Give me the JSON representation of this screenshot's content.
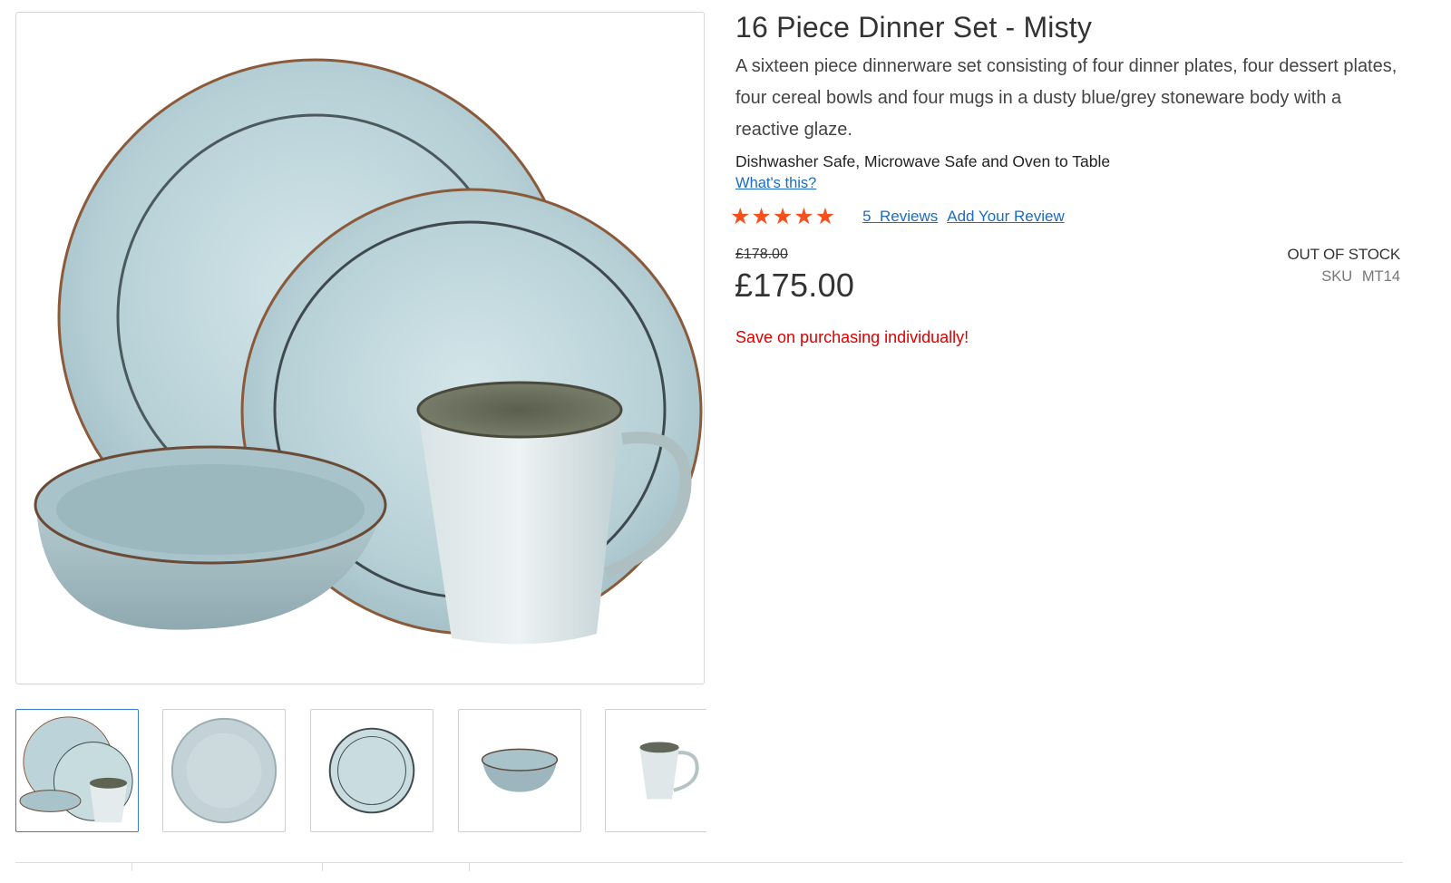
{
  "product": {
    "title": "16 Piece Dinner Set - Misty",
    "description": "A sixteen piece dinnerware set consisting of four dinner plates, four dessert plates, four cereal bowls and four mugs in a dusty blue/grey stoneware body with a reactive glaze.",
    "features": "Dishwasher Safe, Microwave Safe and Oven to Table",
    "whats_this": "What's this?"
  },
  "rating": {
    "stars": 5,
    "review_count_label": "5  Reviews",
    "add_review_label": "Add Your Review",
    "star_color": "#f4511e"
  },
  "pricing": {
    "old_price": "£178.00",
    "price": "£175.00",
    "save_note": "Save on purchasing individually!"
  },
  "stock": {
    "status": "OUT OF STOCK",
    "sku_label": "SKU",
    "sku_value": "MT14"
  },
  "gallery": {
    "thumbnails": [
      "full-set",
      "dinner-plate",
      "dessert-plate",
      "bowl",
      "mug"
    ]
  },
  "colors": {
    "link": "#1a6dc2",
    "sale_red": "#e00000",
    "glaze": "#b9d3d8"
  }
}
